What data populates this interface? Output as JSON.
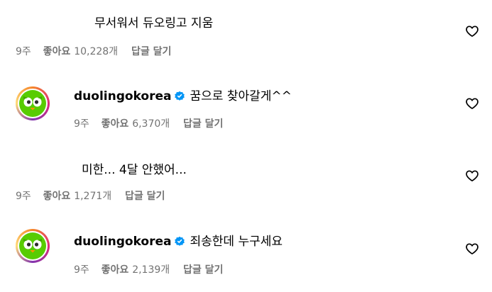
{
  "comments": [
    {
      "has_avatar": false,
      "username": "",
      "text": "무서워서 듀오링고 지움",
      "time": "9주",
      "likes_label": "좋아요",
      "likes_count": "10,228개",
      "reply_label": "답글 달기"
    },
    {
      "has_avatar": true,
      "username": "duolingokorea",
      "verified": true,
      "text": "꿈으로 찾아갈게^^",
      "time": "9주",
      "likes_label": "좋아요",
      "likes_count": "6,370개",
      "reply_label": "답글 달기"
    },
    {
      "has_avatar": false,
      "username": "",
      "text": "미한... 4달 안했어...",
      "time": "9주",
      "likes_label": "좋아요",
      "likes_count": "1,271개",
      "reply_label": "답글 달기"
    },
    {
      "has_avatar": true,
      "username": "duolingokorea",
      "verified": true,
      "text": "죄송한데 누구세요",
      "time": "9주",
      "likes_label": "좋아요",
      "likes_count": "2,139개",
      "reply_label": "답글 달기"
    }
  ],
  "colors": {
    "meta_text": "#737373",
    "verified_badge": "#0095f6",
    "owl_green": "#58cc02"
  },
  "icons": {
    "like": "heart-outline-icon",
    "verified": "verified-badge-icon",
    "avatar": "duolingo-owl-avatar"
  }
}
